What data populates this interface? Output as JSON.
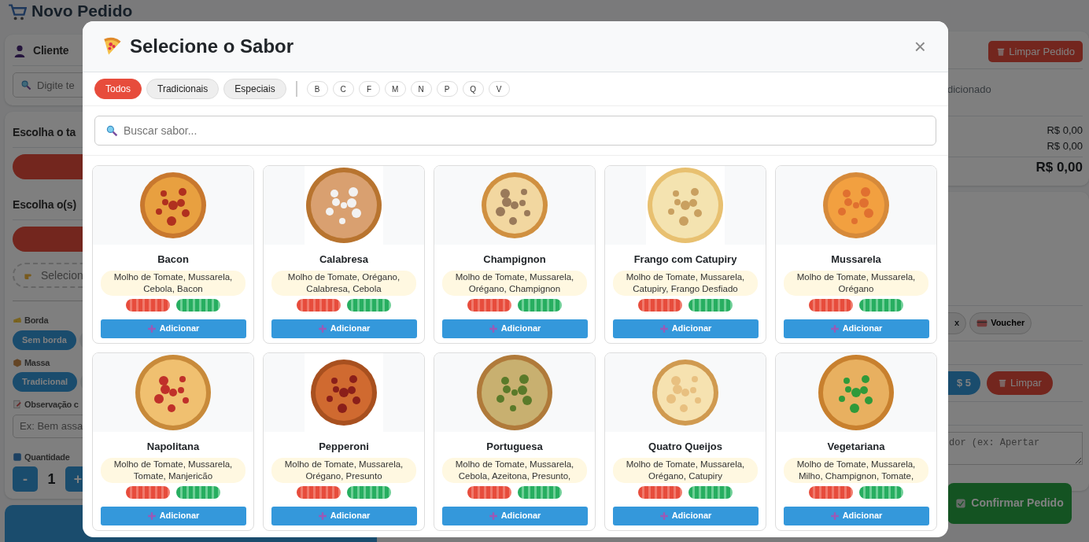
{
  "page": {
    "title": "Novo Pedido"
  },
  "customer": {
    "label": "Cliente",
    "search_placeholder": "Digite te"
  },
  "order_form": {
    "size_heading": "Escolha o ta",
    "flavor_heading": "Escolha o(s)",
    "select_flavor_button": "Selecion",
    "crust": {
      "label": "Borda",
      "options": [
        {
          "label": "Sem borda",
          "selected": true
        },
        {
          "selected": false
        }
      ]
    },
    "dough": {
      "label": "Massa",
      "options": [
        {
          "label": "Tradicional",
          "selected": true
        },
        {
          "selected": false
        }
      ]
    },
    "note": {
      "label": "Observação c",
      "placeholder": "Ex: Bem assa"
    },
    "quantity": {
      "label": "Quantidade",
      "minus": "-",
      "value": "1",
      "plus": "+"
    }
  },
  "summary": {
    "clear_order_button": "Limpar Pedido",
    "empty_text": "dicionado",
    "subtotal": "R$ 0,00",
    "fee": "R$ 0,00",
    "total": "R$ 0,00"
  },
  "payment": {
    "method_tail": "x",
    "voucher_button": "Voucher",
    "amount_chip": "$ 5",
    "clear_button": "Limpar",
    "notes_placeholder": "dor (ex: Apertar",
    "confirm_button": "Confirmar Pedido"
  },
  "modal": {
    "title": "Selecione o Sabor",
    "close": "×",
    "categories": [
      {
        "label": "Todos",
        "selected": true
      },
      {
        "label": "Tradicionais",
        "selected": false
      },
      {
        "label": "Especiais",
        "selected": false
      }
    ],
    "letters": [
      {
        "label": "B",
        "selected": false
      },
      {
        "label": "C",
        "selected": false
      },
      {
        "label": "F",
        "selected": false
      },
      {
        "label": "M",
        "selected": false
      },
      {
        "label": "N",
        "selected": false
      },
      {
        "label": "P",
        "selected": false
      },
      {
        "label": "Q",
        "selected": false
      },
      {
        "label": "V",
        "selected": false
      }
    ],
    "search_placeholder": "Buscar sabor...",
    "flavors": [
      {
        "name": "Bacon",
        "ingredients": "Molho de Tomate, Mussarela, Cebola, Bacon",
        "add_label": "Adicionar"
      },
      {
        "name": "Calabresa",
        "ingredients": "Molho de Tomate, Orégano, Calabresa, Cebola",
        "add_label": "Adicionar"
      },
      {
        "name": "Champignon",
        "ingredients": "Molho de Tomate, Mussarela, Orégano, Champignon",
        "add_label": "Adicionar"
      },
      {
        "name": "Frango com Catupiry",
        "ingredients": "Molho de Tomate, Mussarela, Catupiry, Frango Desfiado",
        "add_label": "Adicionar"
      },
      {
        "name": "Mussarela",
        "ingredients": "Molho de Tomate, Mussarela, Orégano",
        "add_label": "Adicionar"
      },
      {
        "name": "Napolitana",
        "ingredients": "Molho de Tomate, Mussarela, Tomate, Manjericão",
        "add_label": "Adicionar"
      },
      {
        "name": "Pepperoni",
        "ingredients": "Molho de Tomate, Mussarela, Orégano, Presunto",
        "add_label": "Adicionar"
      },
      {
        "name": "Portuguesa",
        "ingredients": "Molho de Tomate, Mussarela, Cebola, Azeitona, Presunto,",
        "add_label": "Adicionar"
      },
      {
        "name": "Quatro Queijos",
        "ingredients": "Molho de Tomate, Mussarela, Orégano, Catupiry",
        "add_label": "Adicionar"
      },
      {
        "name": "Vegetariana",
        "ingredients": "Molho de Tomate, Mussarela, Milho, Champignon, Tomate,",
        "add_label": "Adicionar"
      }
    ]
  }
}
